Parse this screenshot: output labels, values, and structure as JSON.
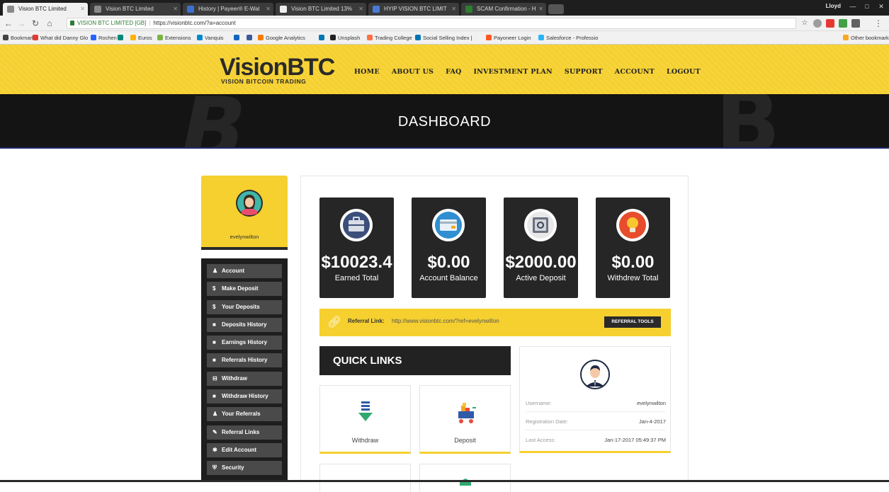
{
  "browser": {
    "tabs": [
      {
        "title": "Vision BTC Limited",
        "active": true
      },
      {
        "title": "Vision BTC Limited"
      },
      {
        "title": "History | Payeer® E-Wal"
      },
      {
        "title": "Vision BTC Limited 13%"
      },
      {
        "title": "HYIP VISION BTC LIMIT"
      },
      {
        "title": "SCAM Confirmation - H"
      }
    ],
    "user": "Lloyd",
    "site_identity": "VISION BTC LIMITED [GB]",
    "url": "https://visionbtc.com/?a=account",
    "bookmarks": [
      "Bookmarks",
      "What did Danny Glo",
      "Rochen",
      "Euros",
      "Extensions",
      "Vanquis",
      "Google Analytics",
      "Unsplash",
      "Trading College",
      "Social Selling Index |",
      "Payoneer Login",
      "Salesforce - Professio",
      "Other bookmarks"
    ]
  },
  "site": {
    "logo": "VisionBTC",
    "logo_tagline": "VISION BITCOIN TRADING",
    "nav": [
      "HOME",
      "ABOUT US",
      "FAQ",
      "INVESTMENT PLAN",
      "SUPPORT",
      "ACCOUNT",
      "LOGOUT"
    ]
  },
  "banner": {
    "title": "DASHBOARD"
  },
  "profile": {
    "username": "evelynwilton"
  },
  "side_menu": [
    {
      "icon": "user-icon",
      "label": "Account"
    },
    {
      "icon": "dollar-icon",
      "label": "Make Deposit"
    },
    {
      "icon": "dollar-icon",
      "label": "Your Deposits"
    },
    {
      "icon": "table-icon",
      "label": "Deposits History"
    },
    {
      "icon": "table-icon",
      "label": "Earnings History"
    },
    {
      "icon": "table-icon",
      "label": "Referrals History"
    },
    {
      "icon": "withdraw-icon",
      "label": "Withdraw"
    },
    {
      "icon": "table-icon",
      "label": "Withdraw History"
    },
    {
      "icon": "users-icon",
      "label": "Your Referrals"
    },
    {
      "icon": "edit-icon",
      "label": "Referral Links"
    },
    {
      "icon": "gear-icon",
      "label": "Edit Account"
    },
    {
      "icon": "shield-icon",
      "label": "Security"
    }
  ],
  "stats": [
    {
      "icon": "briefcase-icon",
      "value": "$10023.4",
      "label": "Earned Total"
    },
    {
      "icon": "credit-card-icon",
      "value": "$0.00",
      "label": "Account Balance"
    },
    {
      "icon": "safe-icon",
      "value": "$2000.00",
      "label": "Active Deposit"
    },
    {
      "icon": "lightbulb-icon",
      "value": "$0.00",
      "label": "Withdrew Total"
    }
  ],
  "referral": {
    "label": "Referral Link:",
    "url": "http://www.visionbtc.com/?ref=evelynwilton",
    "button": "REFERRAL TOOLS"
  },
  "quick_links": {
    "title": "QUICK LINKS",
    "items": [
      {
        "icon": "download-arrow-icon",
        "label": "Withdraw"
      },
      {
        "icon": "shopping-cart-icon",
        "label": "Deposit"
      }
    ]
  },
  "user_info": {
    "rows": [
      {
        "key": "Username:",
        "value": "evelynwilton"
      },
      {
        "key": "Registration Date:",
        "value": "Jan-4-2017"
      },
      {
        "key": "Last Access:",
        "value": "Jan-17-2017 05:49:37 PM"
      }
    ]
  },
  "colors": {
    "accent_yellow": "#f5d02f",
    "dark": "#262626",
    "sidebar": "#1e1e1e"
  }
}
